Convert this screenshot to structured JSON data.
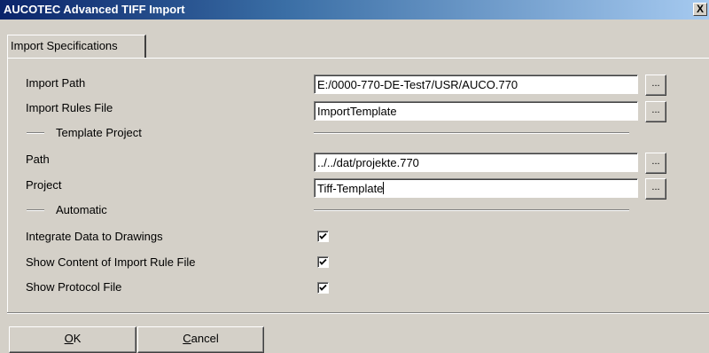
{
  "window": {
    "title": "AUCOTEC  Advanced TIFF Import",
    "close_glyph": "X"
  },
  "tabs": [
    {
      "label": "Import Specifications"
    }
  ],
  "form": {
    "import_path": {
      "label": "Import Path",
      "value": "E:/0000-770-DE-Test7/USR/AUCO.770",
      "browse_label": "..."
    },
    "import_rules_file": {
      "label": "Import Rules File",
      "value": "ImportTemplate",
      "browse_label": "..."
    },
    "template_project_group": {
      "label": "Template Project"
    },
    "path": {
      "label": "Path",
      "value": "../../dat/projekte.770",
      "browse_label": "..."
    },
    "project": {
      "label": "Project",
      "value": "Tiff-Template",
      "browse_label": "..."
    },
    "automatic_group": {
      "label": "Automatic"
    },
    "integrate_data": {
      "label": "Integrate Data to Drawings",
      "checked": true
    },
    "show_content": {
      "label": "Show Content of Import Rule File",
      "checked": true
    },
    "show_protocol": {
      "label": "Show Protocol File",
      "checked": true
    }
  },
  "buttons": {
    "ok": {
      "accel": "O",
      "rest": "K"
    },
    "cancel": {
      "accel": "C",
      "rest": "ancel"
    }
  }
}
